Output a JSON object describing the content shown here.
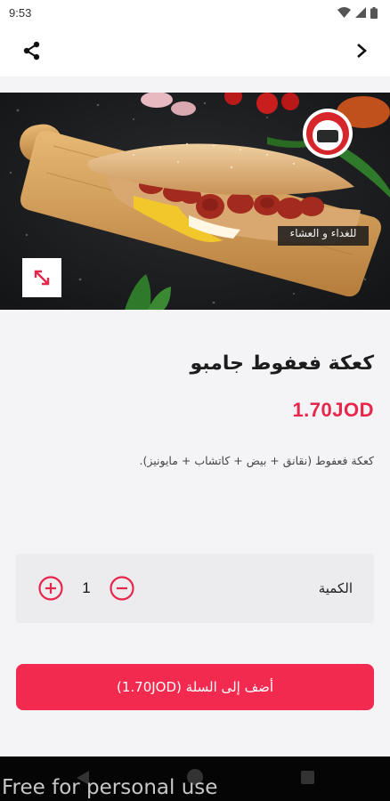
{
  "status_bar": {
    "time": "9:53"
  },
  "header": {
    "share_icon": "share-icon",
    "forward_icon": "chevron-right-icon"
  },
  "product": {
    "badge_text": "للغداء و العشاء",
    "name": "كعكة فعفوط جامبو",
    "price": "1.70JOD",
    "description": "كعكة فعفوط (نقانق + بيض + كاتشاب + مايونيز)."
  },
  "quantity": {
    "label": "الكمية",
    "value": "1"
  },
  "add_to_cart": {
    "label": "أضف إلى السلة (1.70JOD)"
  },
  "watermark": "Free for personal use",
  "colors": {
    "accent": "#f22a50",
    "price": "#e6264b"
  }
}
